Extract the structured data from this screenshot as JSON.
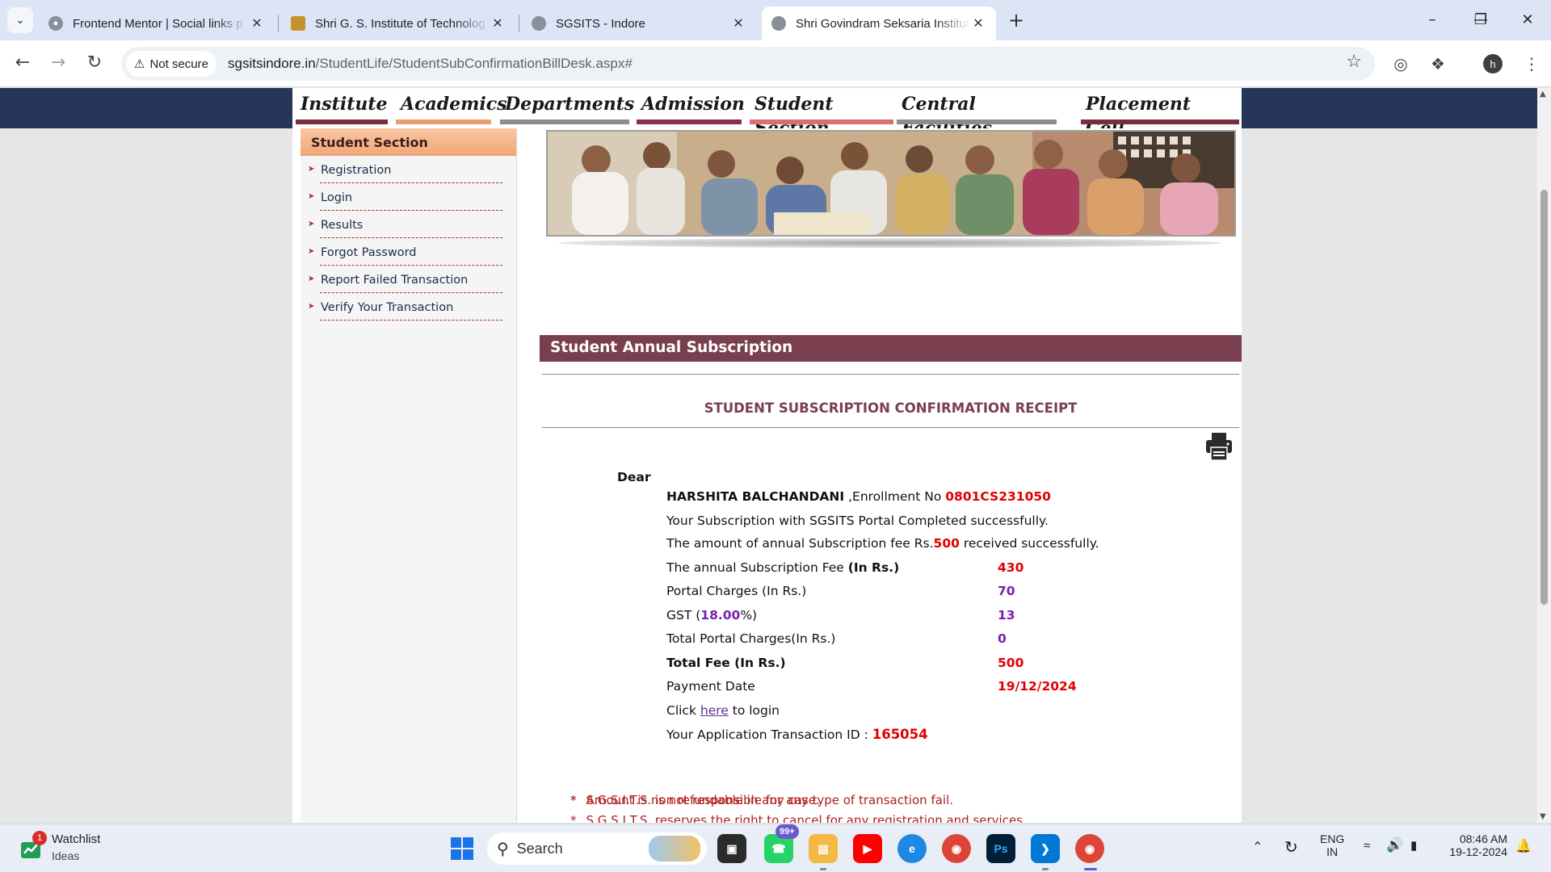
{
  "browser": {
    "tabs": [
      {
        "title": "Frontend Mentor | Social links p",
        "active": false
      },
      {
        "title": "Shri G. S. Institute of Technolog",
        "active": false
      },
      {
        "title": "SGSITS - Indore",
        "active": false
      },
      {
        "title": "Shri Govindram Seksaria Institut",
        "active": true
      }
    ],
    "security_label": "Not secure",
    "url_host": "sgsitsindore.in",
    "url_path": "/StudentLife/StudentSubConfirmationBillDesk.aspx#",
    "profile_initial": "h"
  },
  "site": {
    "menu": [
      {
        "label": "Institute",
        "color": "#7b2d3a"
      },
      {
        "label": "Academics",
        "color": "#e8a070"
      },
      {
        "label": "Departments",
        "color": "#8c8c8c"
      },
      {
        "label": "Admission",
        "color": "#8c2f4a"
      },
      {
        "label": "Student Section",
        "color": "#d96f6f"
      },
      {
        "label": "Central Facilities",
        "color": "#8c8c8c"
      },
      {
        "label": "Placement Cell",
        "color": "#7b2d3a"
      }
    ],
    "sidebar": {
      "heading": "Student Section",
      "items": [
        "Registration",
        "Login",
        "Results",
        "Forgot Password",
        "Report Failed Transaction",
        "Verify Your Transaction"
      ]
    },
    "section_title": "Student Annual Subscription",
    "receipt_title": "STUDENT SUBSCRIPTION CONFIRMATION RECEIPT",
    "receipt": {
      "dear": "Dear",
      "name": "HARSHITA BALCHANDANI",
      "enroll_label": " ,Enrollment No ",
      "enroll_no": "0801CS231050",
      "line_success": "Your  Subscription with SGSITS Portal Completed successfully.",
      "amount_prefix": "The amount of annual Subscription  fee Rs.",
      "amount": "500",
      "amount_suffix": "  received successfully.",
      "fee_label": "The annual Subscription Fee ",
      "fee_unit": "(In Rs.)",
      "fee_value": "430",
      "portal_label": "Portal Charges (In Rs.)",
      "portal_value": "70",
      "gst_prefix": "GST (",
      "gst_rate": "18.00",
      "gst_suffix": "%)",
      "gst_value": "13",
      "total_portal_label": "Total Portal Charges(In Rs.)",
      "total_portal_value": "0",
      "total_fee_label": "Total Fee (In Rs.)",
      "total_fee_value": "500",
      "date_label": "Payment Date",
      "date_value": "19/12/2024",
      "click_prefix": " Click  ",
      "click_link": "here",
      "click_suffix": " to login",
      "txn_label": "Your Application Transaction ID : ",
      "txn_id": "165054"
    },
    "notes": [
      "Amount is non refundable in any case.",
      "S.G.S.I.T.S. reserves the right to cancel for any registration and services.",
      "S.G.S.I.T.S. is not responsible for any type of transaction fail."
    ],
    "note_marker": "*"
  },
  "taskbar": {
    "widget_title": "Watchlist",
    "widget_subtitle": "Ideas",
    "widget_badge": "1",
    "search_placeholder": "Search",
    "whatsapp_badge": "99+",
    "lang_line1": "ENG",
    "lang_line2": "IN",
    "time": "08:46 AM",
    "date": "19-12-2024"
  }
}
